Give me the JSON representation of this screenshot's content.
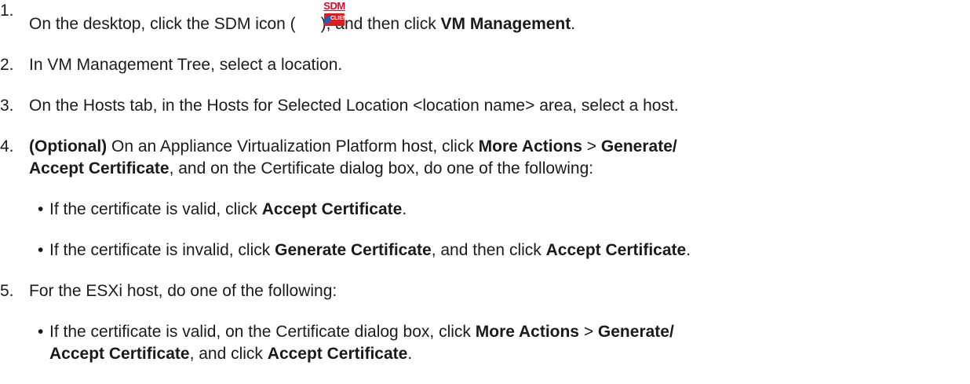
{
  "steps": [
    {
      "num": "1.",
      "pre": "On the desktop, click the SDM icon (",
      "icon": "sdm-client-icon",
      "icon_top": "SDM",
      "icon_bottom": "CLIENT",
      "mid": "), and then click ",
      "bold": "VM Management",
      "post": "."
    },
    {
      "num": "2.",
      "text": "In VM Management Tree, select a location."
    },
    {
      "num": "3.",
      "text": "On the Hosts tab, in the Hosts for Selected Location <location name> area, select a host."
    },
    {
      "num": "4.",
      "bold_prefix": "(Optional)",
      "t1": " On an Appliance Virtualization Platform host, click ",
      "b1": "More Actions",
      "t2": " > ",
      "b2": "Generate/",
      "b3": "Accept Certificate",
      "t3": ", and on the Certificate dialog box, do one of the following:",
      "bullets": [
        {
          "pre": "If the certificate is valid, click ",
          "bold": "Accept Certificate",
          "post": "."
        },
        {
          "pre": "If the certificate is invalid, click ",
          "bold": "Generate Certificate",
          "mid": ", and then click ",
          "bold2": "Accept Certificate",
          "post": "."
        }
      ]
    },
    {
      "num": "5.",
      "text": "For the ESXi host, do one of the following:",
      "bullets": [
        {
          "pre": "If the certificate is valid, on the Certificate dialog box, click ",
          "b1": "More Actions",
          "t2": " > ",
          "b2": "Generate/",
          "b3": "Accept Certificate",
          "t3": ", and click ",
          "b4": "Accept Certificate",
          "post": "."
        }
      ]
    }
  ],
  "bullet_char": "•"
}
